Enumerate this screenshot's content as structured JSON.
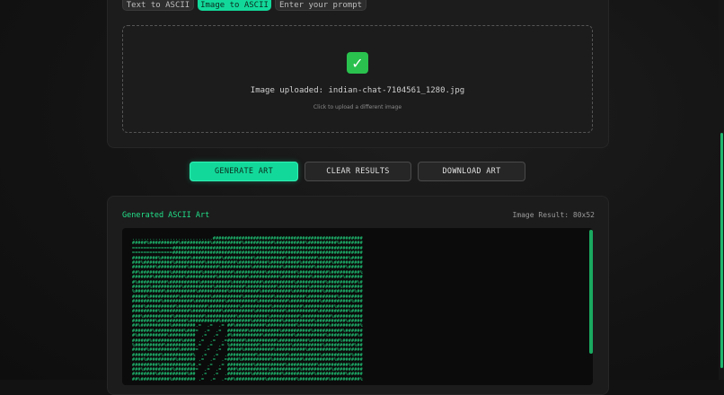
{
  "tabs": [
    {
      "label": "Text to ASCII",
      "active": false
    },
    {
      "label": "Image to ASCII",
      "active": true
    },
    {
      "label": "Enter your prompt",
      "active": false
    }
  ],
  "upload": {
    "status_icon": "check-mark-icon",
    "uploaded_text": "Image uploaded: indian-chat-7104561_1280.jpg",
    "hint": "Click to upload a different image"
  },
  "actions": {
    "generate": "GENERATE ART",
    "clear": "CLEAR RESULTS",
    "download": "DOWNLOAD ART"
  },
  "result": {
    "title": "Generated ASCII Art",
    "meta": "Image Result: 80x52"
  },
  "colors": {
    "accent": "#12d99a",
    "ascii_text": "#22d680",
    "background": "#121212"
  }
}
